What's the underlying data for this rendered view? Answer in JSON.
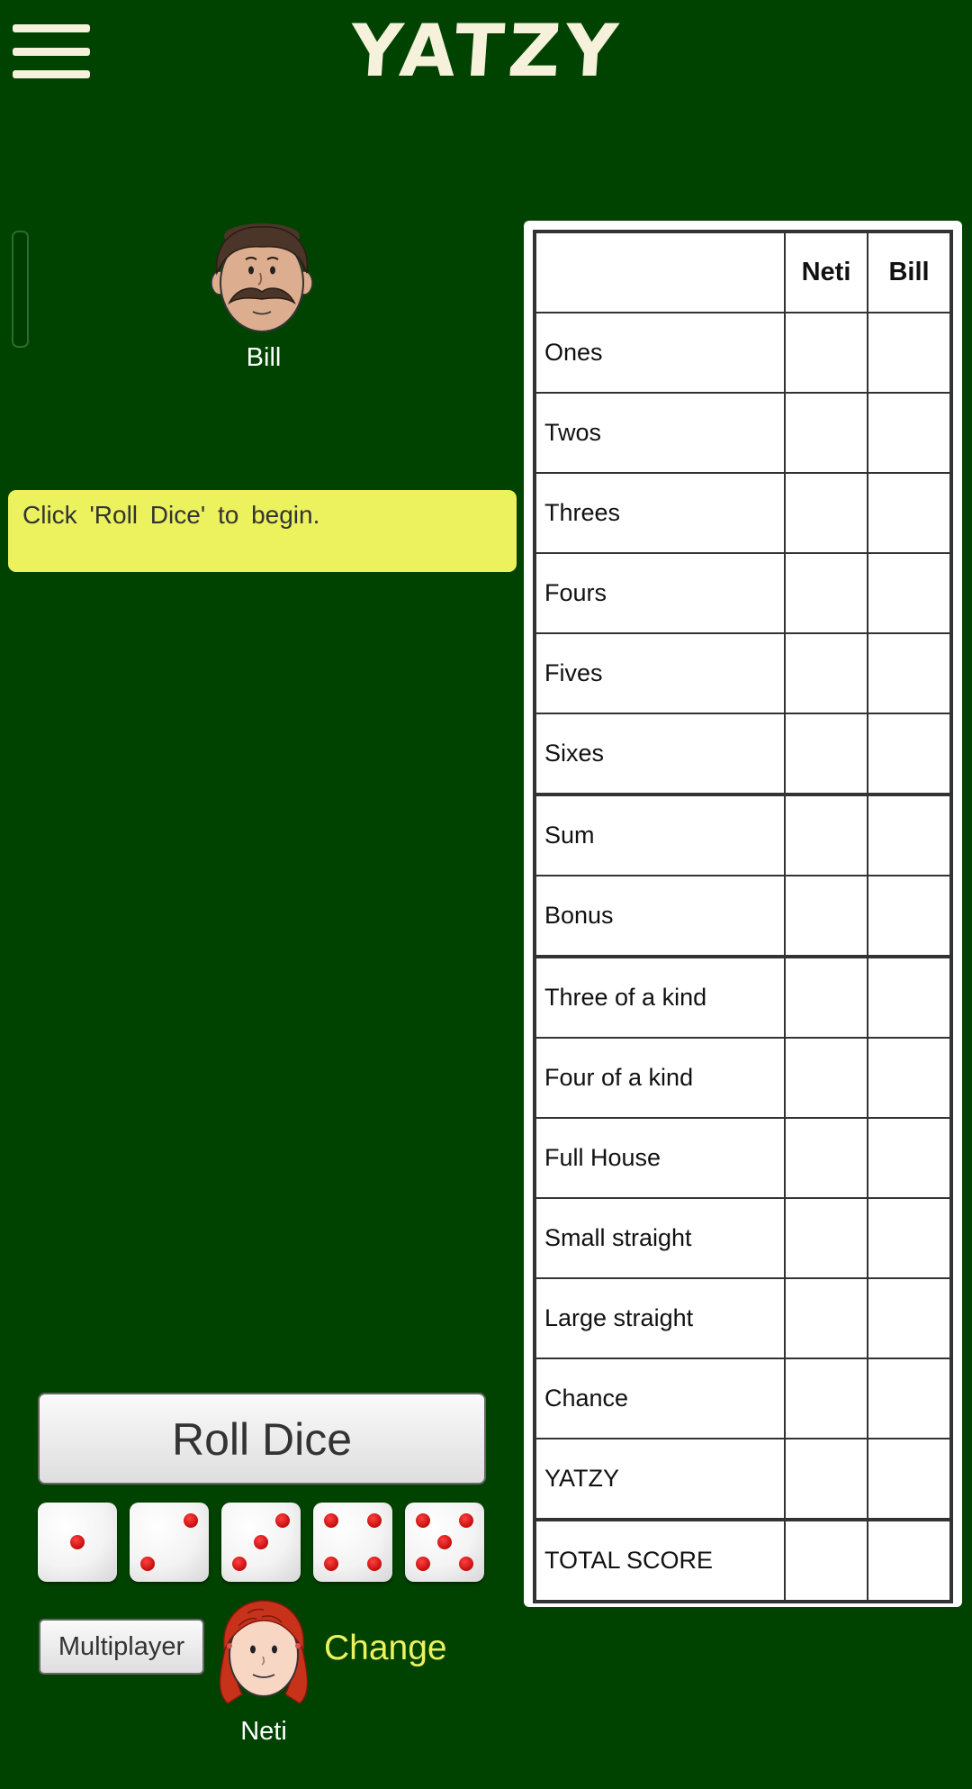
{
  "header": {
    "menu_icon": "hamburger-menu-icon",
    "title": "YATZY"
  },
  "opponent": {
    "name": "Bill",
    "avatar_icon": "mustache-man-avatar"
  },
  "message": "Click 'Roll Dice' to begin.",
  "controls": {
    "roll_label": "Roll Dice",
    "multiplayer_label": "Multiplayer",
    "change_label": "Change"
  },
  "dice": [
    1,
    2,
    3,
    4,
    5
  ],
  "player": {
    "name": "Neti",
    "avatar_icon": "red-haired-girl-avatar"
  },
  "scorecard": {
    "columns": [
      "Neti",
      "Bill"
    ],
    "rows": [
      "Ones",
      "Twos",
      "Threes",
      "Fours",
      "Fives",
      "Sixes",
      "Sum",
      "Bonus",
      "Three of a kind",
      "Four of a kind",
      "Full House",
      "Small straight",
      "Large straight",
      "Chance",
      "YATZY",
      "TOTAL SCORE"
    ],
    "scores": {
      "Neti": [
        "",
        "",
        "",
        "",
        "",
        "",
        "",
        "",
        "",
        "",
        "",
        "",
        "",
        "",
        "",
        ""
      ],
      "Bill": [
        "",
        "",
        "",
        "",
        "",
        "",
        "",
        "",
        "",
        "",
        "",
        "",
        "",
        "",
        "",
        ""
      ]
    }
  },
  "colors": {
    "background": "#004300",
    "title": "#f5f1da",
    "message_background": "#ebf25e",
    "accent_link": "#ebf25e",
    "pip": "#c40d0d"
  }
}
